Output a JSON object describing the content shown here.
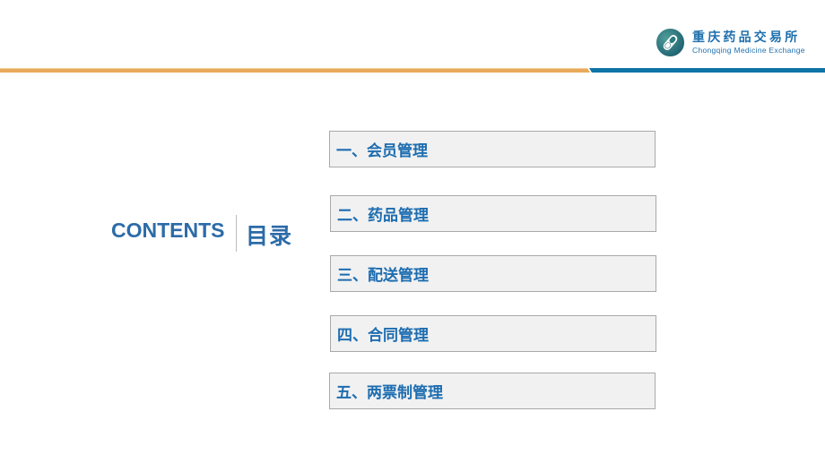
{
  "header": {
    "logo": {
      "icon": "pill-capsule-logo-icon",
      "name_cn": "重庆药品交易所",
      "name_en": "Chongqing Medicine Exchange"
    },
    "band_colors": {
      "left": "#e8aa5a",
      "left_highlight": "#f3cf97",
      "right": "#0f74a6"
    }
  },
  "title": {
    "en": "CONTENTS",
    "cn": "目录",
    "color": "#2c6ba8"
  },
  "toc": {
    "items": [
      {
        "label": "一、会员管理"
      },
      {
        "label": "二、药品管理"
      },
      {
        "label": "三、配送管理"
      },
      {
        "label": "四、合同管理"
      },
      {
        "label": "五、两票制管理"
      }
    ],
    "text_color": "#1d6db0",
    "box_fill": "#f1f1f1",
    "box_border": "#a9a9a9"
  }
}
